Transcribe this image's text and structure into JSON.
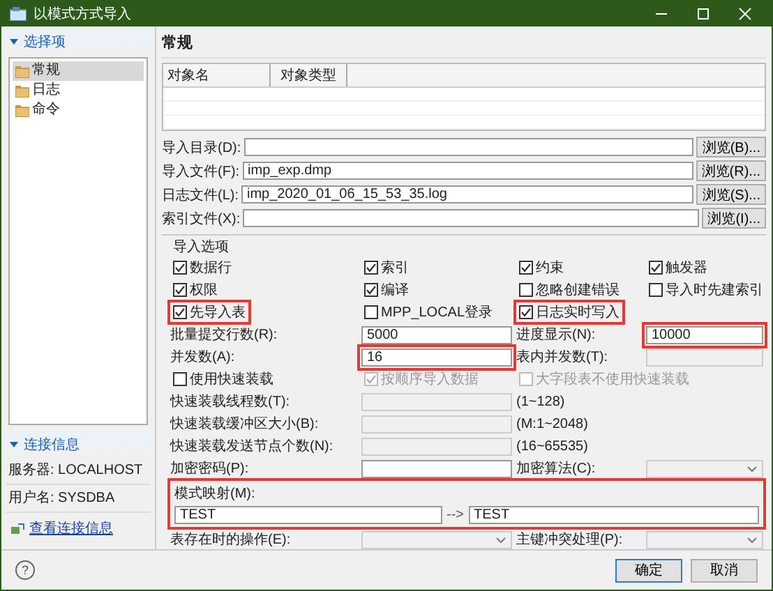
{
  "window": {
    "title": "以模式方式导入"
  },
  "sidebar": {
    "header": "选择项",
    "items": [
      {
        "label": "常规",
        "selected": true
      },
      {
        "label": "日志",
        "selected": false
      },
      {
        "label": "命令",
        "selected": false
      }
    ],
    "connection": {
      "header": "连接信息",
      "lines": [
        "服务器: LOCALHOST",
        "用户名: SYSDBA"
      ],
      "link": "查看连接信息"
    }
  },
  "main": {
    "heading": "常规",
    "table": {
      "columns": [
        "对象名",
        "对象类型"
      ]
    },
    "files": [
      {
        "label": "导入目录(D):",
        "button": "浏览(B)..."
      },
      {
        "label": "导入文件(F):",
        "value": "imp_exp.dmp",
        "button": "浏览(R)..."
      },
      {
        "label": "日志文件(L):",
        "value": "imp_2020_01_06_15_53_35.log",
        "button": "浏览(S)..."
      },
      {
        "label": "索引文件(X):",
        "button": "浏览(I)..."
      }
    ],
    "options": {
      "title": "导入选项",
      "rows": [
        [
          {
            "kind": "check",
            "label": "数据行",
            "checked": true
          },
          {
            "kind": "check",
            "label": "索引",
            "checked": true
          },
          {
            "kind": "check",
            "label": "约束",
            "checked": true
          },
          {
            "kind": "check",
            "label": "触发器",
            "checked": true
          }
        ],
        [
          {
            "kind": "check",
            "label": "权限",
            "checked": true
          },
          {
            "kind": "check",
            "label": "编译",
            "checked": true
          },
          {
            "kind": "check",
            "label": "忽略创建错误",
            "checked": false
          },
          {
            "kind": "check",
            "label": "导入时先建索引",
            "checked": false
          }
        ],
        [
          {
            "kind": "check",
            "label": "先导入表",
            "checked": true,
            "highlighted": true
          },
          {
            "kind": "check",
            "label": "MPP_LOCAL登录",
            "checked": false
          },
          {
            "kind": "check",
            "label": "日志实时写入",
            "checked": true,
            "highlighted": true
          }
        ],
        [
          {
            "kind": "label",
            "text": "批量提交行数(R):"
          },
          {
            "kind": "field",
            "value": "5000"
          },
          {
            "kind": "label",
            "text": "进度显示(N):"
          },
          {
            "kind": "field",
            "value": "10000",
            "highlighted": true
          }
        ],
        [
          {
            "kind": "label",
            "text": "并发数(A):"
          },
          {
            "kind": "field",
            "value": "16",
            "highlighted": true
          },
          {
            "kind": "label",
            "text": "表内并发数(T):"
          },
          {
            "kind": "field",
            "disabled": true
          }
        ],
        [
          {
            "kind": "check",
            "label": "使用快速装载",
            "checked": false
          },
          {
            "kind": "check",
            "label": "按顺序导入数据",
            "checked": true,
            "disabled": true
          },
          {
            "kind": "check",
            "label": "大字段表不使用快速装载",
            "checked": false,
            "disabled": true
          }
        ],
        [
          {
            "kind": "label",
            "text": "快速装载线程数(T):"
          },
          {
            "kind": "field",
            "disabled": true
          },
          {
            "kind": "hint",
            "text": "(1~128)"
          }
        ],
        [
          {
            "kind": "label",
            "text": "快速装载缓冲区大小(B):"
          },
          {
            "kind": "field",
            "disabled": true
          },
          {
            "kind": "hint",
            "text": "(M:1~2048)"
          }
        ],
        [
          {
            "kind": "label",
            "text": "快速装载发送节点个数(N):"
          },
          {
            "kind": "field",
            "disabled": true
          },
          {
            "kind": "hint",
            "text": "(16~65535)"
          }
        ],
        [
          {
            "kind": "label",
            "text": "加密密码(P):"
          },
          {
            "kind": "field"
          },
          {
            "kind": "label",
            "text": "加密算法(C):"
          },
          {
            "kind": "select",
            "disabled": true
          }
        ],
        [
          {
            "kind": "mapping",
            "label": "模式映射(M):",
            "source": "TEST",
            "arrow": "-->",
            "target": "TEST",
            "highlighted": true
          }
        ],
        [
          {
            "kind": "label",
            "text": "表存在时的操作(E):"
          },
          {
            "kind": "select",
            "disabled": true
          },
          {
            "kind": "label",
            "text": "主键冲突处理(P):"
          },
          {
            "kind": "select",
            "disabled": true
          }
        ]
      ]
    }
  },
  "footer": {
    "help": "?",
    "buttons": [
      {
        "label": "确定",
        "default": true
      },
      {
        "label": "取消",
        "default": false
      }
    ]
  }
}
